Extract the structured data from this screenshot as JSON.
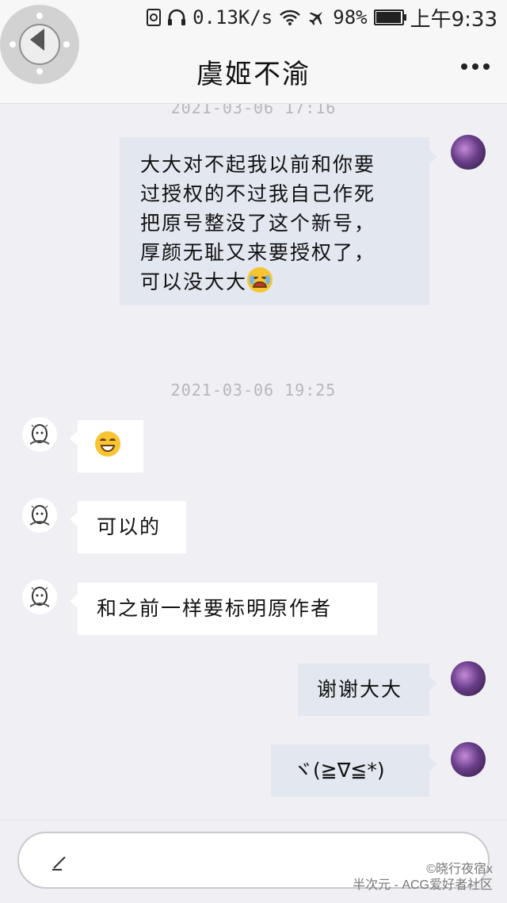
{
  "status_bar": {
    "network_speed": "0.13K/s",
    "battery_percent": "98%",
    "battery_level": 0.98,
    "time": "上午9:33",
    "icons": [
      "sim-icon",
      "headphones-icon",
      "wifi-icon",
      "airplane-icon",
      "battery-icon"
    ]
  },
  "header": {
    "title": "虞姬不渝",
    "back_icon": "back-icon",
    "more_icon": "more-icon"
  },
  "chat": {
    "timestamps": [
      "2021-03-06 17:16",
      "2021-03-06 19:25"
    ],
    "messages": [
      {
        "sender": "me",
        "lines": [
          "大大对不起我以前和你要",
          "过授权的不过我自己作死",
          "把原号整没了这个新号，",
          "厚颜无耻又来要授权了，",
          "可以没大大"
        ],
        "emoji": "crying-emoji"
      },
      {
        "sender": "them",
        "text": "",
        "emoji": "grin-emoji"
      },
      {
        "sender": "them",
        "text": "可以的"
      },
      {
        "sender": "them",
        "text": "和之前一样要标明原作者"
      },
      {
        "sender": "me",
        "text": "谢谢大大"
      },
      {
        "sender": "me",
        "text": "ヾ(≧∇≦*)"
      }
    ]
  },
  "input": {
    "icon": "pencil-icon",
    "placeholder": ""
  },
  "watermark": {
    "line1": "©晓行夜宿x",
    "line2": "半次元 - ACG爱好者社区"
  },
  "colors": {
    "background": "#f0eff4",
    "my_bubble": "#e3e7ef",
    "their_bubble": "#ffffff",
    "timestamp": "#b6b6bb"
  }
}
